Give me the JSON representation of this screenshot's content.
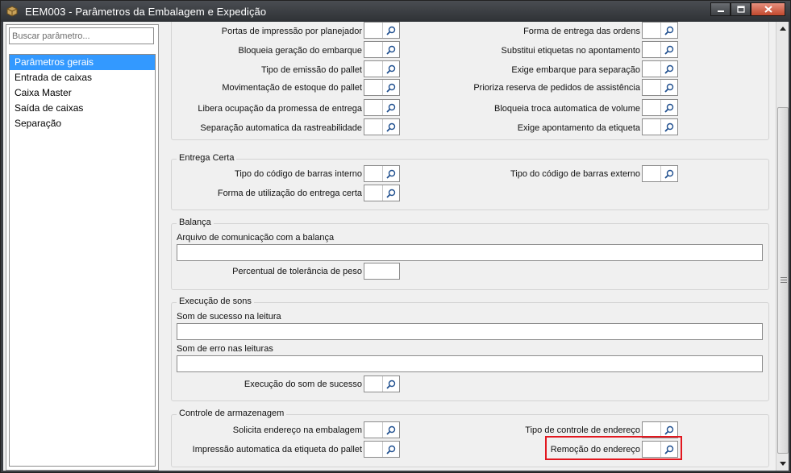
{
  "window": {
    "title": "EEM003 - Parâmetros da Embalagem e Expedição"
  },
  "search": {
    "placeholder": "Buscar parâmetro..."
  },
  "nav": {
    "items": [
      {
        "label": "Parâmetros gerais",
        "selected": true
      },
      {
        "label": "Entrada de caixas"
      },
      {
        "label": "Caixa Master"
      },
      {
        "label": "Saída de caixas"
      },
      {
        "label": "Separação"
      }
    ]
  },
  "general": {
    "left": [
      "Portas de impressão por planejador",
      "Bloqueia geração do embarque",
      "Tipo de emissão do pallet",
      "Movimentação de estoque do pallet",
      "Libera ocupação da promessa de entrega",
      "Separação automatica da rastreabilidade"
    ],
    "right": [
      "Forma de entrega das ordens",
      "Substitui etiquetas no apontamento",
      "Exige embarque para separação",
      "Prioriza reserva de pedidos de assistência",
      "Bloqueia troca automatica de volume",
      "Exige apontamento da etiqueta"
    ]
  },
  "entrega_certa": {
    "title": "Entrega Certa",
    "tipo_interno": "Tipo do código de barras interno",
    "tipo_externo": "Tipo do código de barras externo",
    "forma_uso": "Forma de utilização do entrega certa"
  },
  "balanca": {
    "title": "Balança",
    "arquivo": "Arquivo de comunicação com a balança",
    "percentual": "Percentual de tolerância de peso"
  },
  "sons": {
    "title": "Execução de sons",
    "sucesso": "Som de sucesso na leitura",
    "erro": "Som de erro nas leituras",
    "execucao": "Execução do som de sucesso"
  },
  "armazenagem": {
    "title": "Controle de armazenagem",
    "solicita": "Solicita endereço na embalagem",
    "impressao": "Impressão automatica da etiqueta do pallet",
    "tipo_controle": "Tipo de controle de endereço",
    "remocao": "Remoção do endereço"
  },
  "colors": {
    "selection": "#3399ff",
    "highlight": "#e2171f"
  },
  "icons": {
    "lookup": "magnifier-icon",
    "app": "box-icon"
  }
}
